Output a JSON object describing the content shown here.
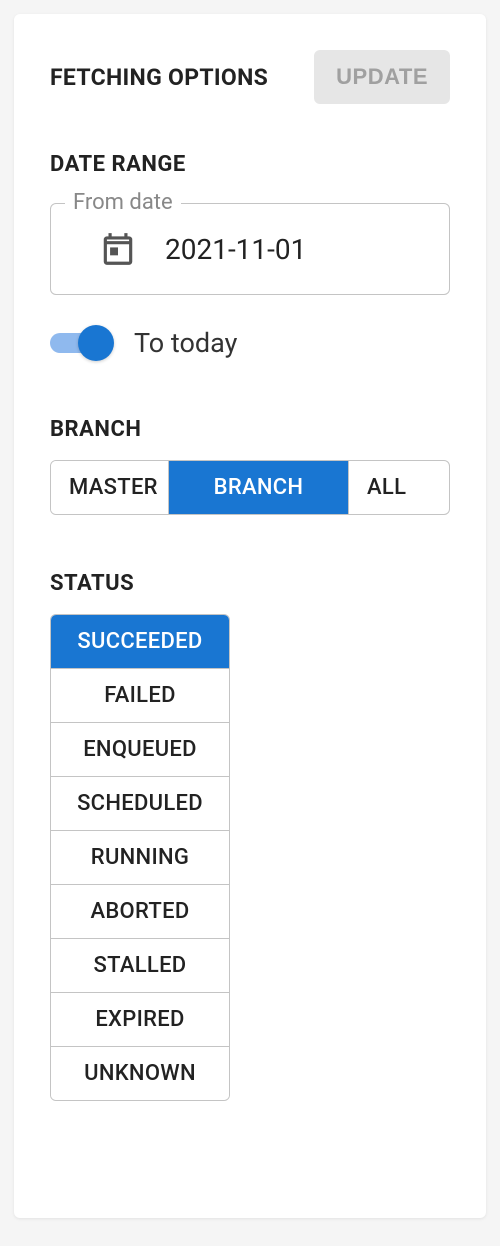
{
  "header": {
    "title": "FETCHING OPTIONS",
    "update_label": "UPDATE"
  },
  "date_range": {
    "title": "DATE RANGE",
    "from_label": "From date",
    "from_value": "2021-11-01",
    "to_today_label": "To today",
    "to_today_enabled": true
  },
  "branch": {
    "title": "BRANCH",
    "options": [
      {
        "label": "MASTER",
        "selected": false
      },
      {
        "label": "BRANCH",
        "selected": true
      },
      {
        "label": "ALL",
        "selected": false
      }
    ]
  },
  "status": {
    "title": "STATUS",
    "options": [
      {
        "label": "SUCCEEDED",
        "selected": true
      },
      {
        "label": "FAILED",
        "selected": false
      },
      {
        "label": "ENQUEUED",
        "selected": false
      },
      {
        "label": "SCHEDULED",
        "selected": false
      },
      {
        "label": "RUNNING",
        "selected": false
      },
      {
        "label": "ABORTED",
        "selected": false
      },
      {
        "label": "STALLED",
        "selected": false
      },
      {
        "label": "EXPIRED",
        "selected": false
      },
      {
        "label": "UNKNOWN",
        "selected": false
      }
    ]
  }
}
